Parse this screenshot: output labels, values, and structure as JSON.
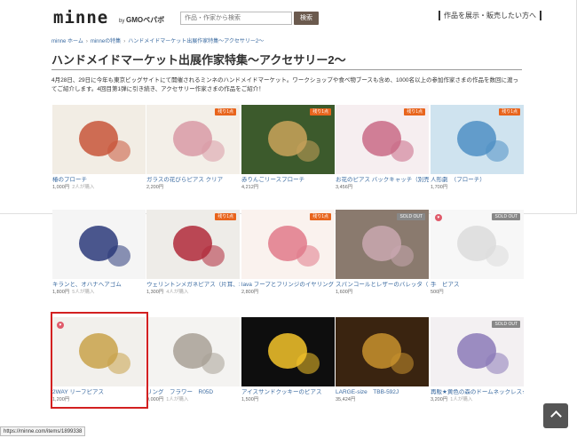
{
  "header": {
    "logo": "minne",
    "logo_by": "by",
    "logo_brand": "GMOペパボ",
    "search_placeholder": "作品・作家から検索",
    "search_button": "検索",
    "seller_link": "作品を展示・販売したい方へ"
  },
  "breadcrumb": [
    "minne ホーム",
    "minneの特集",
    "ハンドメイドマーケット出展作家特集〜アクセサリー2〜"
  ],
  "page_title": "ハンドメイドマーケット出展作家特集〜アクセサリー2〜",
  "intro": "4月28日、29日に今年も東京ビッグサイトにて開催されるミンネのハンドメイドマーケット。ワークショップや食べ物ブースも含め、1000名以上の参加作家さまの作品を数回に渡ってご紹介します。4回目第1弾に引き続き、アクセサリー作家さまの作品をご紹介！",
  "products": [
    {
      "name": "椿のブローチ",
      "price": "1,000円",
      "likes": "2人が購入",
      "badge": "",
      "colors": [
        "#f2ede4",
        "#c8553a"
      ]
    },
    {
      "name": "ガラスの花びらピアス クリア",
      "price": "2,200円",
      "likes": "",
      "badge": "残り1点",
      "colors": [
        "#f3efe8",
        "#d89aa6"
      ]
    },
    {
      "name": "赤りんごリースブローチ",
      "price": "4,212円",
      "likes": "",
      "badge": "残り1点",
      "colors": [
        "#3c5a2c",
        "#c9a35b"
      ]
    },
    {
      "name": "お花のピアス バックキャッチ（別売り）デザイン",
      "price": "3,456円",
      "likes": "",
      "badge": "残り1点",
      "colors": [
        "#f6eef0",
        "#c96a86"
      ]
    },
    {
      "name": "人形劇　（ブローチ）",
      "price": "1,700円",
      "likes": "",
      "badge": "残り1点",
      "colors": [
        "#cfe3ef",
        "#4f8fc4"
      ]
    },
    {
      "name": "キランと、オハナヘアゴム",
      "price": "1,800円",
      "likes": "5人が購入",
      "badge": "",
      "colors": [
        "#f5f5f5",
        "#2b3a7a"
      ]
    },
    {
      "name": "ウェリントンメガネピアス（片耳、ポスト）",
      "price": "1,300円",
      "likes": "4人が購入",
      "badge": "残り1点",
      "colors": [
        "#eeece8",
        "#b02a3a"
      ]
    },
    {
      "name": "lava フープとフリンジのイヤリング",
      "price": "2,800円",
      "likes": "",
      "badge": "残り1点",
      "colors": [
        "#faf2ee",
        "#e07a8a"
      ]
    },
    {
      "name": "スパンコールとレザーのバレッタ（ピンク）",
      "price": "1,600円",
      "likes": "",
      "badge": "SOLD OUT",
      "colors": [
        "#8a7a6e",
        "#c9a8b0"
      ]
    },
    {
      "name": "手　ピアス",
      "price": "500円",
      "likes": "",
      "badge": "SOLD OUT",
      "colors": [
        "#f7f7f7",
        "#dcdcdc"
      ]
    },
    {
      "name": "2WAY リーフピアス",
      "price": "1,200円",
      "likes": "",
      "badge": "",
      "colors": [
        "#f2f0ec",
        "#c9a24a"
      ]
    },
    {
      "name": "リング　フラワー　R05D",
      "price": "9,000円",
      "likes": "1人が購入",
      "badge": "",
      "colors": [
        "#f4f3f1",
        "#a8a096"
      ]
    },
    {
      "name": "アイスサンドクッキーのピアス",
      "price": "1,500円",
      "likes": "",
      "badge": "",
      "colors": [
        "#0e0e0e",
        "#f5c42a"
      ]
    },
    {
      "name": "LARGE-size　TBB-592J",
      "price": "35,424円",
      "likes": "",
      "badge": "",
      "colors": [
        "#3a2410",
        "#c8922e"
      ]
    },
    {
      "name": "再販★黄色の森のドームネックレス★",
      "price": "3,200円",
      "likes": "1人が購入",
      "badge": "SOLD OUT",
      "colors": [
        "#f3f0f2",
        "#8b7ab8"
      ]
    }
  ],
  "status_url": "https://minne.com/items/1899338",
  "back_to_top": "^"
}
